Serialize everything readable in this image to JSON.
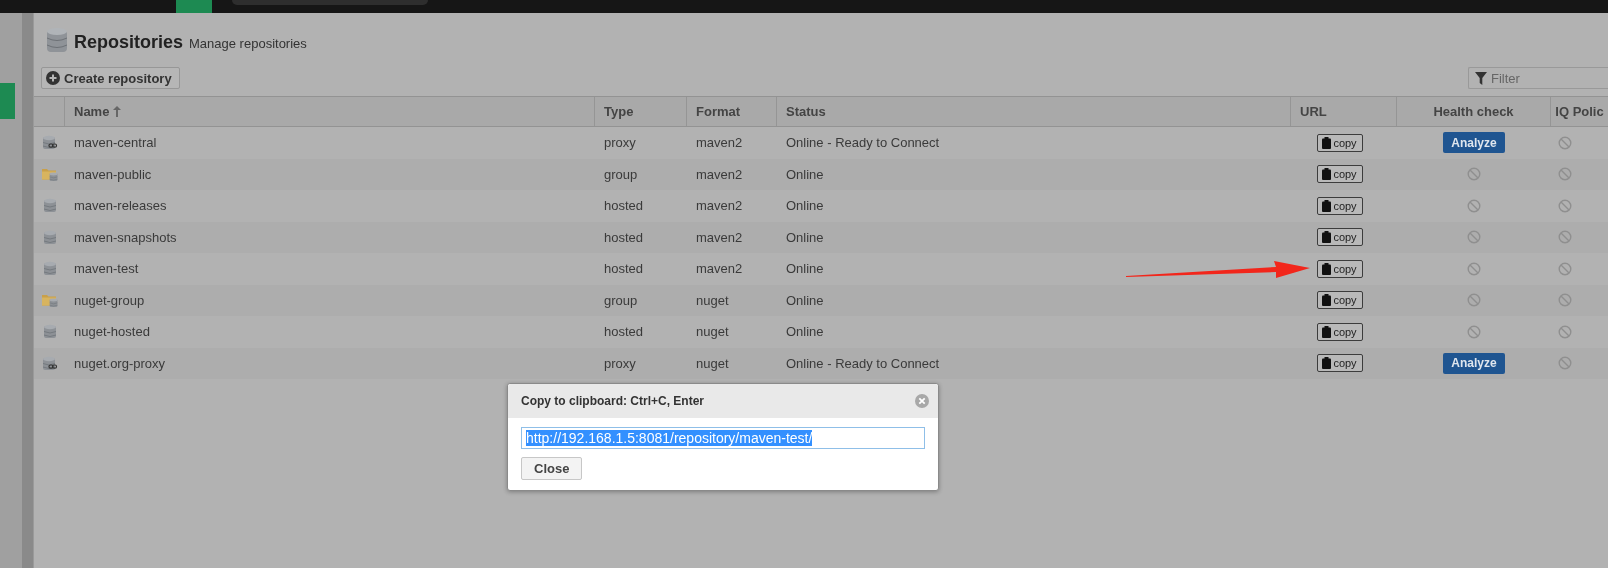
{
  "page": {
    "title": "Repositories",
    "subtitle": "Manage repositories"
  },
  "toolbar": {
    "create_button": "Create repository",
    "filter": {
      "placeholder": "Filter"
    }
  },
  "table": {
    "columns": [
      {
        "label": "Name",
        "sorted": true
      },
      {
        "label": "Type",
        "sorted": false
      },
      {
        "label": "Format",
        "sorted": false
      },
      {
        "label": "Status",
        "sorted": false
      },
      {
        "label": "URL",
        "sorted": false
      },
      {
        "label": "Health check",
        "sorted": false
      },
      {
        "label": "IQ Polic",
        "sorted": false
      }
    ],
    "rows": [
      {
        "kind": "proxy",
        "name": "maven-central",
        "type": "proxy",
        "format": "maven2",
        "status": "Online - Ready to Connect",
        "url_button": "copy",
        "health": {
          "kind": "analyze",
          "label": "Analyze"
        }
      },
      {
        "kind": "group",
        "name": "maven-public",
        "type": "group",
        "format": "maven2",
        "status": "Online",
        "url_button": "copy",
        "health": {
          "kind": "unavailable"
        }
      },
      {
        "kind": "hosted",
        "name": "maven-releases",
        "type": "hosted",
        "format": "maven2",
        "status": "Online",
        "url_button": "copy",
        "health": {
          "kind": "unavailable"
        }
      },
      {
        "kind": "hosted",
        "name": "maven-snapshots",
        "type": "hosted",
        "format": "maven2",
        "status": "Online",
        "url_button": "copy",
        "health": {
          "kind": "unavailable"
        }
      },
      {
        "kind": "hosted",
        "name": "maven-test",
        "type": "hosted",
        "format": "maven2",
        "status": "Online",
        "url_button": "copy",
        "health": {
          "kind": "unavailable"
        }
      },
      {
        "kind": "group",
        "name": "nuget-group",
        "type": "group",
        "format": "nuget",
        "status": "Online",
        "url_button": "copy",
        "health": {
          "kind": "unavailable"
        }
      },
      {
        "kind": "hosted",
        "name": "nuget-hosted",
        "type": "hosted",
        "format": "nuget",
        "status": "Online",
        "url_button": "copy",
        "health": {
          "kind": "unavailable"
        }
      },
      {
        "kind": "proxy",
        "name": "nuget.org-proxy",
        "type": "proxy",
        "format": "nuget",
        "status": "Online - Ready to Connect",
        "url_button": "copy",
        "health": {
          "kind": "analyze",
          "label": "Analyze"
        }
      }
    ]
  },
  "dialog": {
    "title": "Copy to clipboard: Ctrl+C, Enter",
    "value": "http://192.168.1.5:8081/repository/maven-test/",
    "text_selected": true,
    "close_button": "Close"
  }
}
